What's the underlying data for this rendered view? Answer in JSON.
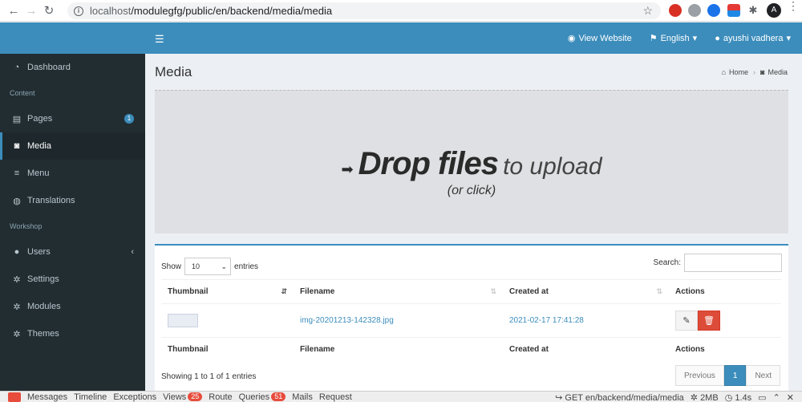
{
  "browser": {
    "url_host": "localhost",
    "url_path": "/modulegfg/public/en/backend/media/media",
    "avatar_letter": "A"
  },
  "navbar": {
    "view_website": "View Website",
    "language": "English",
    "user": "ayushi vadhera"
  },
  "sidebar": {
    "items": [
      {
        "label": "Dashboard"
      },
      {
        "header": "Content"
      },
      {
        "label": "Pages",
        "badge": "1"
      },
      {
        "label": "Media"
      },
      {
        "label": "Menu"
      },
      {
        "label": "Translations"
      },
      {
        "header": "Workshop"
      },
      {
        "label": "Users"
      },
      {
        "label": "Settings"
      },
      {
        "label": "Modules"
      },
      {
        "label": "Themes"
      }
    ]
  },
  "page": {
    "title": "Media",
    "breadcrumb": {
      "home": "Home",
      "current": "Media"
    }
  },
  "dropzone": {
    "strong": "Drop files",
    "light": "to upload",
    "sub": "(or click)"
  },
  "table": {
    "show_label": "Show",
    "entries_label": "entries",
    "page_size": "10",
    "search_label": "Search:",
    "headers": [
      "Thumbnail",
      "Filename",
      "Created at",
      "Actions"
    ],
    "rows": [
      {
        "filename": "img-20201213-142328.jpg",
        "created_at": "2021-02-17 17:41:28"
      }
    ],
    "info": "Showing 1 to 1 of 1 entries",
    "pager": {
      "previous": "Previous",
      "current": "1",
      "next": "Next"
    }
  },
  "debugbar": {
    "tabs": [
      "Messages",
      "Timeline",
      "Exceptions",
      "Views",
      "Route",
      "Queries",
      "Mails",
      "Request"
    ],
    "views_count": "25",
    "queries_count": "51",
    "request": "GET en/backend/media/media",
    "memory": "2MB",
    "time": "1.4s"
  },
  "colors": {
    "primary": "#3c8dbc",
    "sidebar_bg": "#222d32",
    "danger": "#dd4b39"
  }
}
